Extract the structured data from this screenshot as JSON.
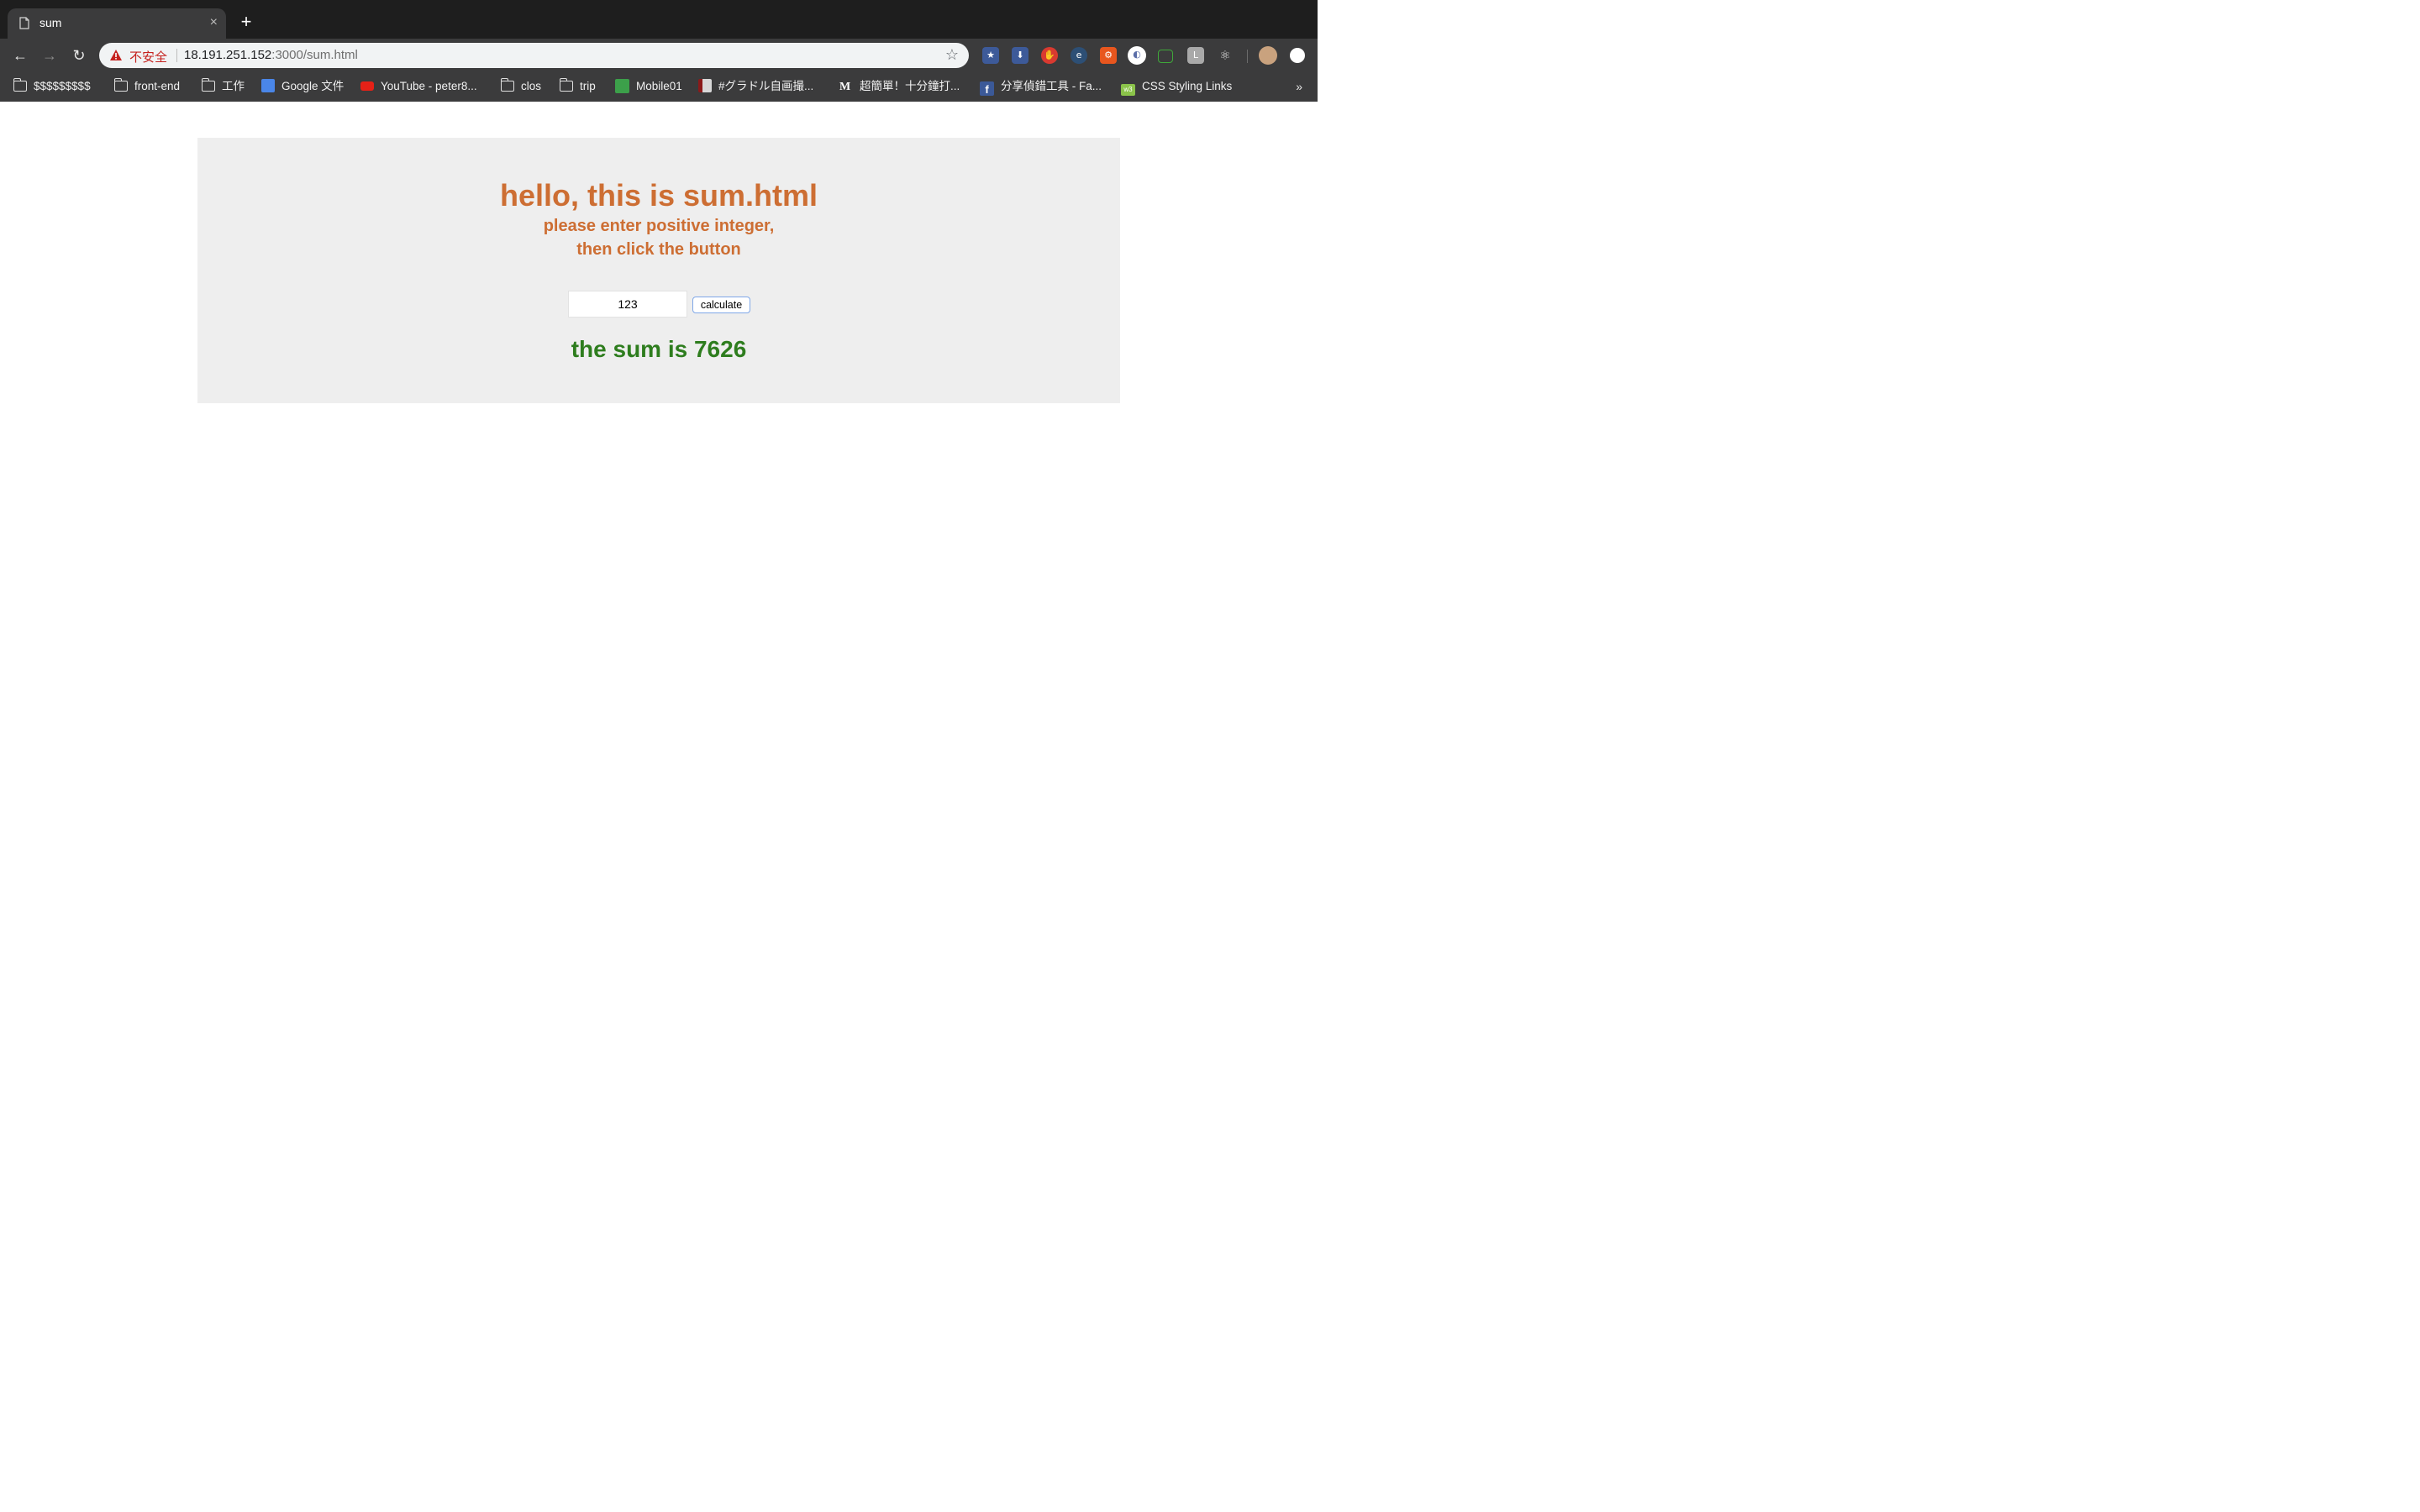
{
  "browser": {
    "tab": {
      "title": "sum",
      "close_glyph": "×",
      "icon": "document-icon"
    },
    "new_tab_glyph": "+",
    "nav": {
      "back_glyph": "←",
      "forward_glyph": "→",
      "reload_glyph": "↻"
    },
    "omnibox": {
      "security_label": "不安全",
      "url_host": "18.191.251.152",
      "url_rest": ":3000/sum.html",
      "star_glyph": "☆"
    },
    "extensions": [
      "bookmark-star-icon",
      "download-icon",
      "adblock-icon",
      "ghostery-icon",
      "settings-extension-icon",
      "cookie-icon",
      "screen-capture-icon",
      "l-extension-icon",
      "react-devtools-icon",
      "profile-avatar",
      "extension-dot-icon"
    ],
    "ext_letters": {
      "l_ext": "L",
      "ghostery": "e"
    },
    "bookmarks": [
      {
        "label": "$$$$$$$$$",
        "icon": "folder-icon"
      },
      {
        "label": "front-end",
        "icon": "folder-icon"
      },
      {
        "label": "工作",
        "icon": "folder-icon"
      },
      {
        "label": "Google 文件",
        "icon": "google-docs-icon"
      },
      {
        "label": "YouTube - peter8...",
        "icon": "youtube-icon"
      },
      {
        "label": "clos",
        "icon": "folder-icon"
      },
      {
        "label": "trip",
        "icon": "folder-icon"
      },
      {
        "label": "Mobile01",
        "icon": "mobile01-icon"
      },
      {
        "label": "#グラドル自画撮...",
        "icon": "site-icon"
      },
      {
        "label": "超簡單！十分鐘打...",
        "icon": "medium-icon"
      },
      {
        "label": "分享偵錯工具 - Fa...",
        "icon": "facebook-icon"
      },
      {
        "label": "CSS Styling Links",
        "icon": "w3schools-icon"
      }
    ],
    "bookmarks_more": "»",
    "medium_letter": "M",
    "facebook_letter": "f",
    "w3_letter": "w3"
  },
  "page": {
    "heading": "hello, this is sum.html",
    "instruction_line1": "please enter positive integer,",
    "instruction_line2": "then click the button",
    "input_value": "123",
    "button_label": "calculate",
    "result_text": "the sum is 7626"
  },
  "colors": {
    "heading": "#cd6e33",
    "result": "#2e7d1e",
    "panel_bg": "#eeeeee"
  }
}
